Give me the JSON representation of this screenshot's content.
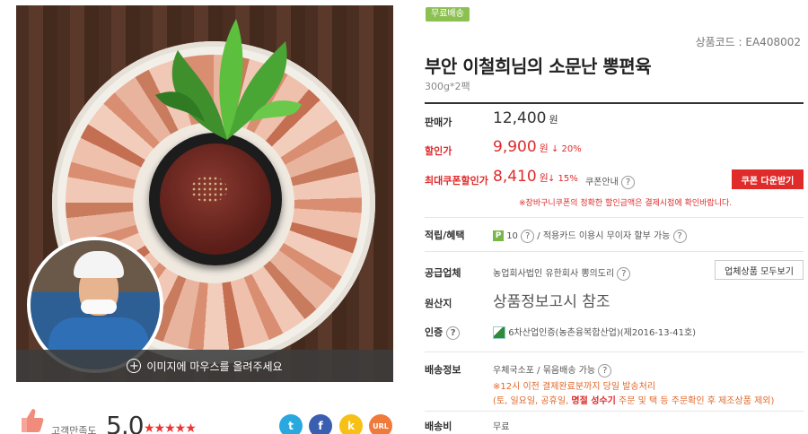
{
  "image": {
    "hover_hint": "이미지에 마우스를 올려주세요"
  },
  "rating": {
    "label": "고객만족도",
    "value": "5.0",
    "stars": "★★★★★"
  },
  "share": {
    "twitter": "t",
    "facebook": "f",
    "kakao": "k",
    "url": "URL"
  },
  "product": {
    "badge": "무료배송",
    "code": "상품코드 : EA408002",
    "title": "부안 이철희님의 소문난 뽕편육",
    "subtitle": "300g*2팩"
  },
  "price": {
    "sale_label": "판매가",
    "sale_price": "12,400",
    "won": "원",
    "discount_label": "할인가",
    "discount_price": "9,900",
    "discount_pct": "↓ 20%",
    "coupon_label": "최대쿠폰할인가",
    "coupon_price": "8,410",
    "coupon_pct": "↓ 15%",
    "coupon_info": "쿠폰안내",
    "coupon_button": "쿠폰 다운받기",
    "coupon_notice": "※장바구니쿠폰의 정확한 할인금액은 결제시점에 확인바랍니다."
  },
  "points": {
    "label": "적립/혜택",
    "p_icon": "P",
    "amount": "10",
    "card_info": "적용카드 이용시 무이자 할부 가능"
  },
  "supplier": {
    "label": "공급업체",
    "name": "농업회사법인 유한회사 뽕의도리",
    "all_products": "업체상품 모두보기"
  },
  "origin": {
    "label": "원산지",
    "value": "상품정보고시 참조"
  },
  "cert": {
    "label": "인증",
    "value": "6차산업인증(농촌융복합산업)(제2016-13-41호)"
  },
  "shipping": {
    "label": "배송정보",
    "method": "우체국소포 / 묶음배송 가능",
    "note1": "※12시 이전 결제완료분까지 당일 발송처리",
    "note2_pre": "(토, 일요일, 공휴일, ",
    "note2_bold": "명절 성수기",
    "note2_post": " 주문 및 택 등 주문확인 후 제조상품 제외)"
  },
  "fee": {
    "label": "배송비",
    "value": "무료"
  },
  "colors": {
    "accent_red": "#e02b2b",
    "badge_green": "#8cc152"
  }
}
